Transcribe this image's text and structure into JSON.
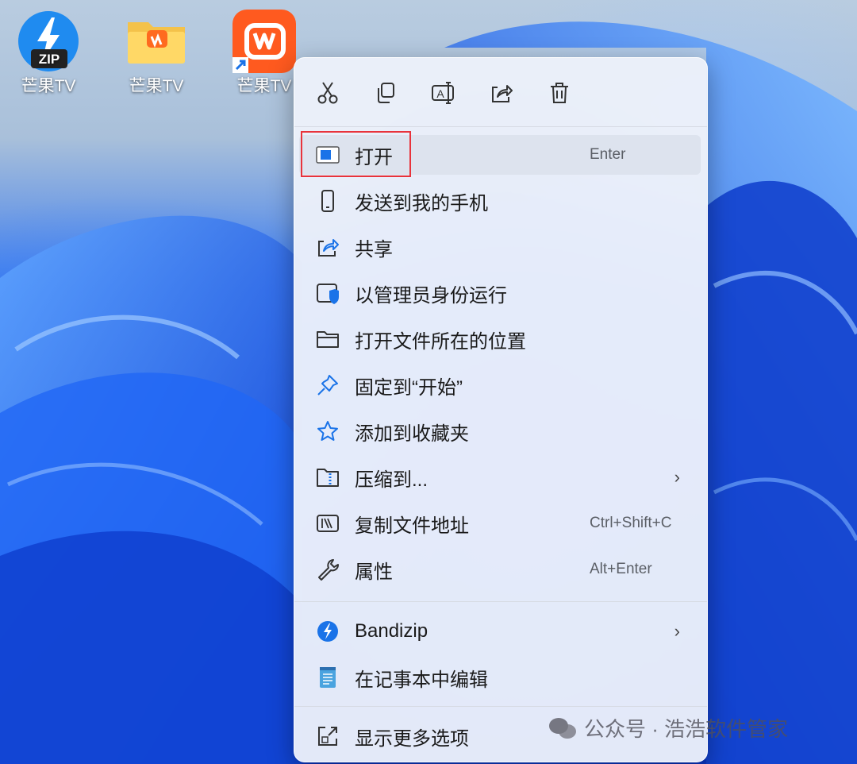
{
  "desktop": {
    "icons": [
      {
        "label": "芒果TV",
        "icon": "bandizip-zip-icon"
      },
      {
        "label": "芒果TV",
        "icon": "folder-icon"
      },
      {
        "label": "芒果TV",
        "icon": "mango-tv-shortcut-icon"
      }
    ]
  },
  "context_menu": {
    "toolbar": [
      {
        "name": "cut",
        "icon": "scissors-icon"
      },
      {
        "name": "copy",
        "icon": "copy-icon"
      },
      {
        "name": "rename",
        "icon": "rename-icon"
      },
      {
        "name": "share",
        "icon": "share-icon"
      },
      {
        "name": "delete",
        "icon": "trash-icon"
      }
    ],
    "items": [
      {
        "label": "打开",
        "shortcut": "Enter",
        "icon": "open-app-icon"
      },
      {
        "label": "发送到我的手机",
        "shortcut": "",
        "icon": "phone-icon"
      },
      {
        "label": "共享",
        "shortcut": "",
        "icon": "share-icon"
      },
      {
        "label": "以管理员身份运行",
        "shortcut": "",
        "icon": "admin-shield-icon"
      },
      {
        "label": "打开文件所在的位置",
        "shortcut": "",
        "icon": "folder-icon"
      },
      {
        "label": "固定到“开始”",
        "shortcut": "",
        "icon": "pin-icon"
      },
      {
        "label": "添加到收藏夹",
        "shortcut": "",
        "icon": "star-icon"
      },
      {
        "label": "压缩到...",
        "shortcut": "",
        "icon": "zip-folder-icon",
        "submenu": true
      },
      {
        "label": "复制文件地址",
        "shortcut": "Ctrl+Shift+C",
        "icon": "copy-path-icon"
      },
      {
        "label": "属性",
        "shortcut": "Alt+Enter",
        "icon": "wrench-icon"
      },
      {
        "label": "Bandizip",
        "shortcut": "",
        "icon": "bandizip-icon",
        "submenu": true
      },
      {
        "label": "在记事本中编辑",
        "shortcut": "",
        "icon": "notepad-icon"
      },
      {
        "label": "显示更多选项",
        "shortcut": "",
        "icon": "more-options-icon"
      }
    ],
    "submenu_glyph": "›"
  },
  "watermark": {
    "text": "公众号 · 浩浩软件管家"
  },
  "colors": {
    "highlight_border": "#e8333b",
    "accent_blue": "#1a73e8"
  }
}
